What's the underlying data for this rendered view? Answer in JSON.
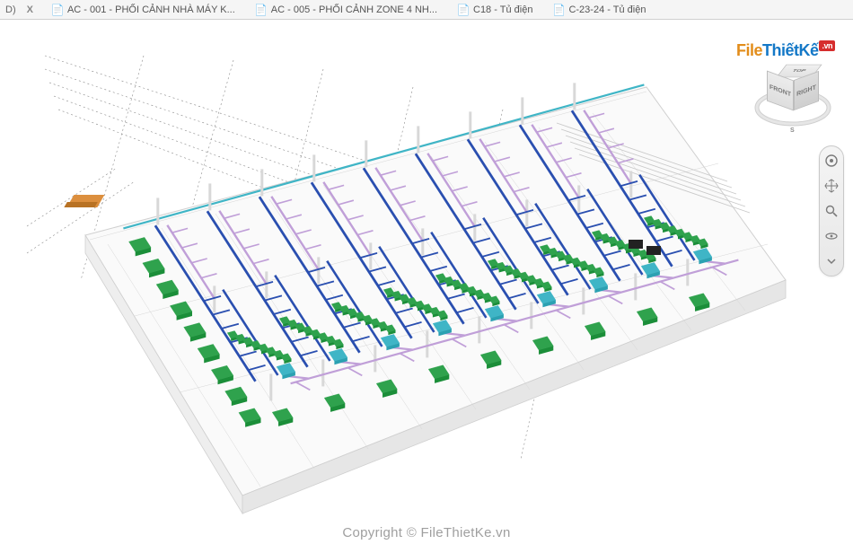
{
  "tabs": {
    "prefix": "D)",
    "items": [
      {
        "label": "AC - 001 - PHỐI CẢNH NHÀ MÁY K...",
        "icon": "sheet-icon"
      },
      {
        "label": "AC - 005 - PHỐI CẢNH ZONE 4 NH...",
        "icon": "sheet-icon"
      },
      {
        "label": "C18 - Tủ điện",
        "icon": "sheet-icon"
      },
      {
        "label": "C-23-24 - Tủ điện",
        "icon": "sheet-icon"
      }
    ],
    "close": "X"
  },
  "watermark": {
    "logo": {
      "file": "File",
      "thietke": "ThiếtKế",
      "vn": ".vn"
    },
    "copyright": "Copyright © FileThietKe.vn"
  },
  "viewcube": {
    "faces": {
      "top": "TOP",
      "front": "FRONT",
      "right": "RIGHT"
    },
    "compass": {
      "s": "S"
    }
  },
  "navbar": {
    "tools": [
      "steering-wheel",
      "pan",
      "zoom",
      "orbit",
      "chevron-down"
    ]
  },
  "model": {
    "colors": {
      "duct_supply": "#2a4fb0",
      "duct_return": "#c09fd8",
      "unit_ahu": "#2fa24d",
      "unit_fcu": "#3fb5c6",
      "equipment": "#dc8f3e",
      "electrical": "#222222",
      "structure": "#d8d8d8",
      "gridline": "#888888"
    },
    "bays": 9,
    "description": "Isometric MEP 3D perspective of factory HVAC system with blue supply ducts, purple return ducts, green AHUs along perimeter, teal FCUs, light-gray structural columns/beams, dashed grid lines."
  }
}
